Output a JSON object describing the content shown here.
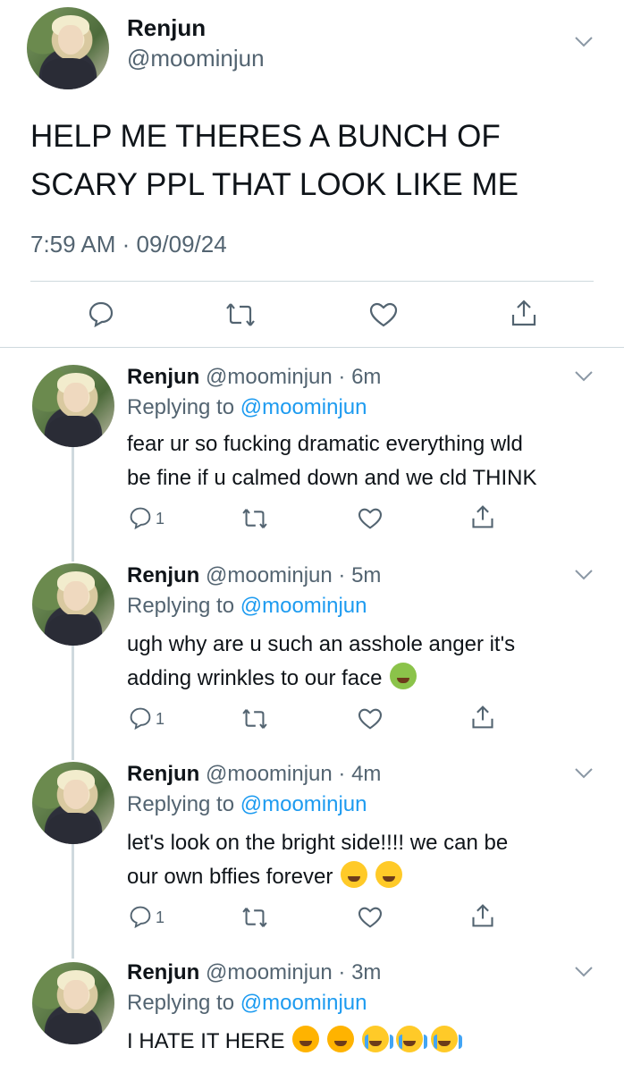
{
  "main_tweet": {
    "name": "Renjun",
    "handle": "@moominjun",
    "text_line1": "HELP ME THERES A BUNCH OF",
    "text_line2": "SCARY PPL THAT LOOK LIKE ME",
    "timestamp": "7:59 AM · 09/09/24"
  },
  "replies": [
    {
      "name": "Renjun",
      "meta": "@moominjun · 6m",
      "replying_prefix": "Replying to ",
      "replying_to": "@moominjun",
      "text_line1": "fear ur so fucking dramatic everything wld",
      "text_line2": "be fine if u calmed down and we cld THINK",
      "reply_count": "1"
    },
    {
      "name": "Renjun",
      "meta": "@moominjun · 5m",
      "replying_prefix": "Replying to ",
      "replying_to": "@moominjun",
      "text_line1": "ugh why are u such an asshole anger it's",
      "text_line2": "adding wrinkles to our face",
      "reply_count": "1"
    },
    {
      "name": "Renjun",
      "meta": "@moominjun · 4m",
      "replying_prefix": "Replying to ",
      "replying_to": "@moominjun",
      "text_line1": "let's look on the bright side!!!! we can be",
      "text_line2": "our own bffies forever",
      "reply_count": "1"
    },
    {
      "name": "Renjun",
      "meta": "@moominjun · 3m",
      "replying_prefix": "Replying to ",
      "replying_to": "@moominjun",
      "text_line1": "I HATE IT HERE"
    }
  ],
  "icons": {
    "reply": "reply-icon",
    "retweet": "retweet-icon",
    "like": "like-icon",
    "share": "share-icon",
    "more": "chevron-down-icon",
    "emoji_sick": "nauseated-face-emoji",
    "emoji_laugh": "laughing-face-emoji",
    "emoji_angry": "confounded-face-emoji",
    "emoji_cry": "crying-face-emoji"
  },
  "colors": {
    "link": "#1d9bf0",
    "muted": "#536471",
    "divider": "#cfd9de"
  }
}
